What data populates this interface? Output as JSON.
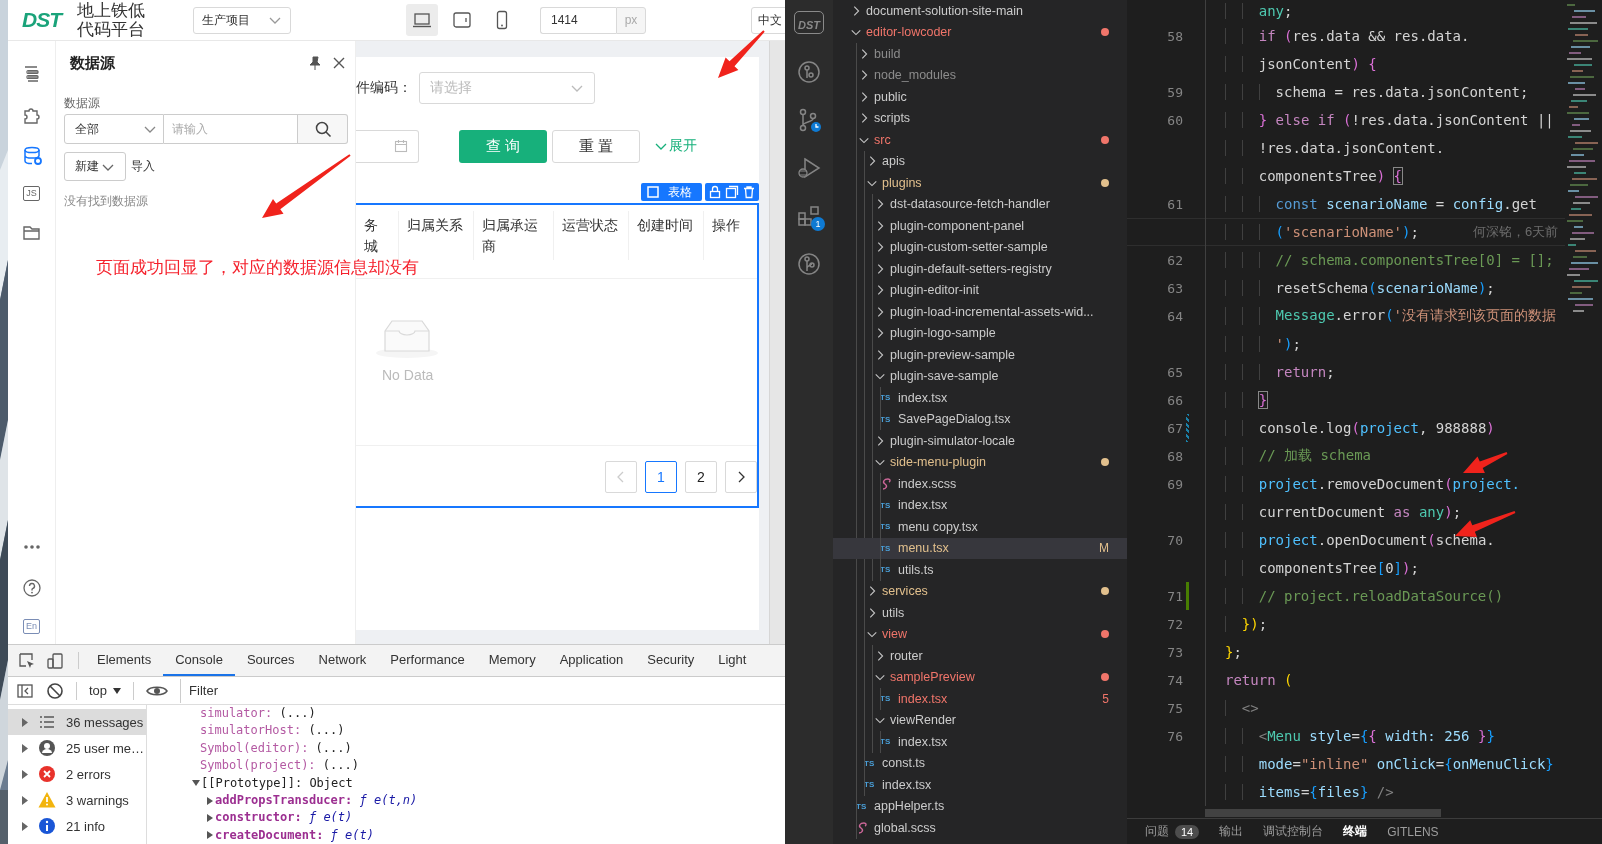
{
  "browser": {
    "header": {
      "logo": "DST",
      "title": "地上铁低代码平台",
      "project_select": "生产项目",
      "devices": [
        {
          "kind": "desktop",
          "selected": true
        },
        {
          "kind": "tablet",
          "selected": false
        },
        {
          "kind": "phone",
          "selected": false
        }
      ],
      "width_value": "1414",
      "width_unit": "px",
      "language": "中文"
    },
    "rail": {
      "items": [
        {
          "kind": "outline",
          "selected": false
        },
        {
          "kind": "component",
          "selected": false
        },
        {
          "kind": "datasource",
          "selected": true
        },
        {
          "kind": "js",
          "label": "JS",
          "selected": false
        },
        {
          "kind": "folder",
          "selected": false
        }
      ],
      "bottom": [
        {
          "kind": "more"
        },
        {
          "kind": "help"
        },
        {
          "kind": "lang",
          "label": "En"
        }
      ]
    },
    "panel": {
      "title": "数据源",
      "filter_label": "数据源",
      "type_select": "全部",
      "search_placeholder": "请输入",
      "new_button": "新建",
      "import": "导入",
      "empty": "没有找到数据源"
    },
    "canvas": {
      "field_label": "件编码：",
      "field_placeholder": "请选择",
      "query_button": "查 询",
      "reset_button": "重 置",
      "expand_link": "展开",
      "component_tag": "表格",
      "columns": [
        "务城",
        "归属关系",
        "归属承运商",
        "运营状态",
        "创建时间",
        "操作"
      ],
      "empty": "No Data",
      "pagination": {
        "prev_disabled": true,
        "next_disabled": false,
        "pages": [
          {
            "label": "1",
            "selected": true
          },
          {
            "label": "2",
            "selected": false
          }
        ]
      }
    },
    "annotation": "页面成功回显了，对应的数据源信息却没有"
  },
  "devtools": {
    "tabs": [
      {
        "label": "Elements",
        "selected": false
      },
      {
        "label": "Console",
        "selected": true
      },
      {
        "label": "Sources",
        "selected": false
      },
      {
        "label": "Network",
        "selected": false
      },
      {
        "label": "Performance",
        "selected": false
      },
      {
        "label": "Memory",
        "selected": false
      },
      {
        "label": "Application",
        "selected": false
      },
      {
        "label": "Security",
        "selected": false
      },
      {
        "label": "Light",
        "selected": false
      }
    ],
    "context": "top",
    "filter_placeholder": "Filter",
    "sidebar": [
      {
        "kind": "messages",
        "label": "36 messages",
        "selected": true
      },
      {
        "kind": "user",
        "label": "25 user me…",
        "selected": false
      },
      {
        "kind": "error",
        "label": "2 errors",
        "selected": false
      },
      {
        "kind": "warning",
        "label": "3 warnings",
        "selected": false
      },
      {
        "kind": "info",
        "label": "21 info",
        "selected": false
      }
    ],
    "lines": [
      {
        "kind": "prop",
        "key": "simulator:",
        "value": "(...)"
      },
      {
        "kind": "prop",
        "key": "simulatorHost:",
        "value": "(...)"
      },
      {
        "kind": "prop",
        "key": "Symbol(editor):",
        "value": "(...)"
      },
      {
        "kind": "prop",
        "key": "Symbol(project):",
        "value": "(...)"
      },
      {
        "kind": "proto",
        "key": "[[Prototype]]:",
        "value": "Object",
        "expanded": true
      },
      {
        "kind": "method",
        "key": "addPropsTransducer:",
        "value": "ƒ e(t,n)",
        "expanded": false
      },
      {
        "kind": "method",
        "key": "constructor:",
        "value": "ƒ e(t)",
        "expanded": false
      },
      {
        "kind": "method",
        "key": "createDocument:",
        "value": "ƒ e(t)",
        "expanded": false
      }
    ]
  },
  "activity_bar": [
    {
      "kind": "logo",
      "label": "DST"
    },
    {
      "kind": "graph"
    },
    {
      "kind": "scm"
    },
    {
      "kind": "debug"
    },
    {
      "kind": "extensions",
      "badge": "1"
    },
    {
      "kind": "gitlens"
    }
  ],
  "explorer": {
    "tree": [
      {
        "name": "document-solution-site-main",
        "kind": "folder",
        "expanded": false,
        "selected": false
      },
      {
        "name": "editor-lowcoder",
        "kind": "folder",
        "expanded": true,
        "selected": false,
        "color": "#f0756a",
        "dot": true,
        "children": [
          {
            "name": "build",
            "kind": "folder",
            "expanded": false,
            "selected": false,
            "color": "#8c8c8c"
          },
          {
            "name": "node_modules",
            "kind": "folder",
            "expanded": false,
            "selected": false,
            "color": "#8c8c8c"
          },
          {
            "name": "public",
            "kind": "folder",
            "expanded": false,
            "selected": false
          },
          {
            "name": "scripts",
            "kind": "folder",
            "expanded": false,
            "selected": false
          },
          {
            "name": "src",
            "kind": "folder",
            "expanded": true,
            "selected": false,
            "color": "#f0756a",
            "dot": true,
            "children": [
              {
                "name": "apis",
                "kind": "folder",
                "expanded": false,
                "selected": false
              },
              {
                "name": "plugins",
                "kind": "folder",
                "expanded": true,
                "selected": false,
                "color": "#e2c08d",
                "dot": true,
                "children": [
                  {
                    "name": "dst-datasource-fetch-handler",
                    "kind": "folder",
                    "expanded": false,
                    "selected": false
                  },
                  {
                    "name": "plugin-component-panel",
                    "kind": "folder",
                    "expanded": false,
                    "selected": false
                  },
                  {
                    "name": "plugin-custom-setter-sample",
                    "kind": "folder",
                    "expanded": false,
                    "selected": false
                  },
                  {
                    "name": "plugin-default-setters-registry",
                    "kind": "folder",
                    "expanded": false,
                    "selected": false
                  },
                  {
                    "name": "plugin-editor-init",
                    "kind": "folder",
                    "expanded": false,
                    "selected": false
                  },
                  {
                    "name": "plugin-load-incremental-assets-wid...",
                    "kind": "folder",
                    "expanded": false,
                    "selected": false
                  },
                  {
                    "name": "plugin-logo-sample",
                    "kind": "folder",
                    "expanded": false,
                    "selected": false
                  },
                  {
                    "name": "plugin-preview-sample",
                    "kind": "folder",
                    "expanded": false,
                    "selected": false
                  },
                  {
                    "name": "plugin-save-sample",
                    "kind": "folder",
                    "expanded": true,
                    "selected": false,
                    "children": [
                      {
                        "name": "index.tsx",
                        "kind": "ts",
                        "icon_text": "TS",
                        "selected": false
                      },
                      {
                        "name": "SavePageDialog.tsx",
                        "kind": "ts",
                        "icon_text": "TS",
                        "selected": false
                      }
                    ]
                  },
                  {
                    "name": "plugin-simulator-locale",
                    "kind": "folder",
                    "expanded": false,
                    "selected": false
                  },
                  {
                    "name": "side-menu-plugin",
                    "kind": "folder",
                    "expanded": true,
                    "selected": false,
                    "color": "#e2c08d",
                    "dot": true,
                    "children": [
                      {
                        "name": "index.scss",
                        "kind": "scss",
                        "selected": false
                      },
                      {
                        "name": "index.tsx",
                        "kind": "ts",
                        "icon_text": "TS",
                        "selected": false
                      },
                      {
                        "name": "menu copy.tsx",
                        "kind": "ts",
                        "icon_text": "TS",
                        "selected": false
                      },
                      {
                        "name": "menu.tsx",
                        "kind": "ts",
                        "icon_text": "TS",
                        "selected": true,
                        "color": "#e2c08d",
                        "badge": "M"
                      },
                      {
                        "name": "utils.ts",
                        "kind": "ts",
                        "icon_text": "TS",
                        "selected": false
                      }
                    ]
                  }
                ]
              },
              {
                "name": "services",
                "kind": "folder",
                "expanded": false,
                "selected": false,
                "color": "#e2c08d",
                "dot": true
              },
              {
                "name": "utils",
                "kind": "folder",
                "expanded": false,
                "selected": false
              },
              {
                "name": "view",
                "kind": "folder",
                "expanded": true,
                "selected": false,
                "color": "#f0756a",
                "dot": true,
                "children": [
                  {
                    "name": "router",
                    "kind": "folder",
                    "expanded": false,
                    "selected": false
                  },
                  {
                    "name": "samplePreview",
                    "kind": "folder",
                    "expanded": true,
                    "selected": false,
                    "color": "#f0756a",
                    "dot": true,
                    "children": [
                      {
                        "name": "index.tsx",
                        "kind": "ts",
                        "icon_text": "TS",
                        "selected": false,
                        "color": "#f0756a",
                        "badge": "5"
                      }
                    ]
                  },
                  {
                    "name": "viewRender",
                    "kind": "folder",
                    "expanded": true,
                    "selected": false,
                    "children": [
                      {
                        "name": "index.tsx",
                        "kind": "ts",
                        "icon_text": "TS",
                        "selected": false
                      }
                    ]
                  }
                ]
              },
              {
                "name": "const.ts",
                "kind": "ts",
                "icon_text": "TS",
                "selected": false
              },
              {
                "name": "index.tsx",
                "kind": "ts",
                "icon_text": "TS",
                "selected": false
              }
            ]
          },
          {
            "name": "appHelper.ts",
            "kind": "ts",
            "icon_text": "TS",
            "selected": false
          },
          {
            "name": "global.scss",
            "kind": "scss",
            "selected": false
          }
        ]
      }
    ]
  },
  "editor": {
    "blame": "何深铭，6天前",
    "rows": [
      {
        "tokens": [
          {
            "text": "    any",
            "kind": "type"
          },
          {
            "text": ";",
            "kind": "plain"
          }
        ]
      },
      {
        "line": "58",
        "tokens": [
          {
            "text": "    if",
            "kind": "kw"
          },
          {
            "text": " (",
            "kind": "br1"
          },
          {
            "text": "res.data && res.data.",
            "kind": "plain"
          }
        ]
      },
      {
        "tokens": [
          {
            "text": "    jsonContent",
            "kind": "plain"
          },
          {
            "text": ")",
            "kind": "br1"
          },
          {
            "text": " {",
            "kind": "br1"
          }
        ]
      },
      {
        "line": "59",
        "tokens": [
          {
            "text": "      schema = res.data.jsonContent;",
            "kind": "plain"
          }
        ]
      },
      {
        "line": "60",
        "tokens": [
          {
            "text": "    }",
            "kind": "br1"
          },
          {
            "text": " else if ",
            "kind": "kw"
          },
          {
            "text": "(",
            "kind": "br1"
          },
          {
            "text": "!res.data.jsonContent ||",
            "kind": "plain"
          }
        ]
      },
      {
        "tokens": [
          {
            "text": "    !res.data.jsonContent.",
            "kind": "plain"
          }
        ]
      },
      {
        "tokens": [
          {
            "text": "    componentsTree",
            "kind": "plain"
          },
          {
            "text": ")",
            "kind": "br1"
          },
          {
            "text": " {",
            "kind": "br1",
            "boxed": true
          }
        ]
      },
      {
        "line": "61",
        "tokens": [
          {
            "text": "      const",
            "kind": "decl"
          },
          {
            "text": " scenarioName",
            "kind": "var"
          },
          {
            "text": " = ",
            "kind": "plain"
          },
          {
            "text": "config",
            "kind": "var"
          },
          {
            "text": ".get",
            "kind": "plain"
          }
        ]
      },
      {
        "current": true,
        "blame": true,
        "tokens": [
          {
            "text": "      (",
            "kind": "br2"
          },
          {
            "text": "'scenarioName'",
            "kind": "str"
          },
          {
            "text": ")",
            "kind": "br2"
          },
          {
            "text": ";",
            "kind": "plain"
          }
        ]
      },
      {
        "line": "62",
        "tokens": [
          {
            "text": "      // schema.componentsTree[0] = [];",
            "kind": "cmt"
          }
        ]
      },
      {
        "line": "63",
        "tokens": [
          {
            "text": "      resetSchema",
            "kind": "plain"
          },
          {
            "text": "(",
            "kind": "br2"
          },
          {
            "text": "scenarioName",
            "kind": "var"
          },
          {
            "text": ")",
            "kind": "br2"
          },
          {
            "text": ";",
            "kind": "plain"
          }
        ]
      },
      {
        "line": "64",
        "tokens": [
          {
            "text": "      Message",
            "kind": "type"
          },
          {
            "text": ".error",
            "kind": "plain"
          },
          {
            "text": "(",
            "kind": "br2"
          },
          {
            "text": "'没有请求到该页面的数据",
            "kind": "str"
          }
        ]
      },
      {
        "tokens": [
          {
            "text": "      '",
            "kind": "str"
          },
          {
            "text": ")",
            "kind": "br2"
          },
          {
            "text": ";",
            "kind": "plain"
          }
        ]
      },
      {
        "line": "65",
        "tokens": [
          {
            "text": "      return",
            "kind": "kw"
          },
          {
            "text": ";",
            "kind": "plain"
          }
        ]
      },
      {
        "line": "66",
        "tokens": [
          {
            "text": "    }",
            "kind": "br1",
            "boxed": true
          }
        ]
      },
      {
        "line": "67",
        "modified": true,
        "tokens": [
          {
            "text": "    console.log",
            "kind": "plain"
          },
          {
            "text": "(",
            "kind": "br1"
          },
          {
            "text": "project",
            "kind": "obj"
          },
          {
            "text": ", 988888",
            "kind": "plain"
          },
          {
            "text": ")",
            "kind": "br1"
          }
        ]
      },
      {
        "line": "68",
        "tokens": [
          {
            "text": "    // 加载 schema",
            "kind": "cmt"
          }
        ]
      },
      {
        "line": "69",
        "tokens": [
          {
            "text": "    project",
            "kind": "obj"
          },
          {
            "text": ".removeDocument",
            "kind": "plain"
          },
          {
            "text": "(",
            "kind": "br1"
          },
          {
            "text": "project.",
            "kind": "obj"
          }
        ]
      },
      {
        "tokens": [
          {
            "text": "    currentDocument",
            "kind": "plain"
          },
          {
            "text": " as ",
            "kind": "kw"
          },
          {
            "text": "any",
            "kind": "type"
          },
          {
            "text": ")",
            "kind": "br1"
          },
          {
            "text": ";",
            "kind": "plain"
          }
        ]
      },
      {
        "line": "70",
        "tokens": [
          {
            "text": "    project",
            "kind": "obj"
          },
          {
            "text": ".openDocument",
            "kind": "plain"
          },
          {
            "text": "(",
            "kind": "br1"
          },
          {
            "text": "schema.",
            "kind": "plain"
          }
        ]
      },
      {
        "tokens": [
          {
            "text": "    componentsTree",
            "kind": "plain"
          },
          {
            "text": "[",
            "kind": "br2"
          },
          {
            "text": "0",
            "kind": "plain"
          },
          {
            "text": "]",
            "kind": "br2"
          },
          {
            "text": ")",
            "kind": "br1"
          },
          {
            "text": ";",
            "kind": "plain"
          }
        ]
      },
      {
        "line": "71",
        "added": true,
        "tokens": [
          {
            "text": "    // project.reloadDataSource()",
            "kind": "cmt"
          }
        ]
      },
      {
        "line": "72",
        "tokens": [
          {
            "text": "  }",
            "kind": "br3"
          },
          {
            "text": ")",
            "kind": "br3"
          },
          {
            "text": ";",
            "kind": "plain"
          }
        ]
      },
      {
        "line": "73",
        "tokens": [
          {
            "text": "}",
            "kind": "br3"
          },
          {
            "text": ";",
            "kind": "plain"
          }
        ]
      },
      {
        "line": "74",
        "tokens": [
          {
            "text": "return",
            "kind": "kw"
          },
          {
            "text": " (",
            "kind": "br3"
          }
        ]
      },
      {
        "line": "75",
        "tokens": [
          {
            "text": "  <>",
            "kind": "tag"
          }
        ]
      },
      {
        "line": "76",
        "tokens": [
          {
            "text": "    <",
            "kind": "tag"
          },
          {
            "text": "Menu",
            "kind": "type"
          },
          {
            "text": " style",
            "kind": "var"
          },
          {
            "text": "=",
            "kind": "plain"
          },
          {
            "text": "{",
            "kind": "br2"
          },
          {
            "text": "{",
            "kind": "br1"
          },
          {
            "text": " width: 256 ",
            "kind": "var"
          },
          {
            "text": "}",
            "kind": "br1"
          },
          {
            "text": "}",
            "kind": "br2"
          }
        ]
      },
      {
        "tokens": [
          {
            "text": "    mode",
            "kind": "var"
          },
          {
            "text": "=",
            "kind": "plain"
          },
          {
            "text": "\"inline\"",
            "kind": "str"
          },
          {
            "text": " onClick",
            "kind": "var"
          },
          {
            "text": "=",
            "kind": "plain"
          },
          {
            "text": "{",
            "kind": "br2"
          },
          {
            "text": "onMenuClick",
            "kind": "var"
          },
          {
            "text": "}",
            "kind": "br2"
          }
        ]
      },
      {
        "tokens": [
          {
            "text": "    items",
            "kind": "var"
          },
          {
            "text": "=",
            "kind": "plain"
          },
          {
            "text": "{",
            "kind": "br2"
          },
          {
            "text": "files",
            "kind": "var"
          },
          {
            "text": "}",
            "kind": "br2"
          },
          {
            "text": " />",
            "kind": "tag"
          }
        ]
      }
    ]
  },
  "panel_tabs": [
    {
      "label": "问题",
      "badge": "14",
      "selected": false
    },
    {
      "label": "输出",
      "selected": false
    },
    {
      "label": "调试控制台",
      "selected": false
    },
    {
      "label": "终端",
      "selected": true
    },
    {
      "label": "GITLENS",
      "selected": false
    }
  ]
}
